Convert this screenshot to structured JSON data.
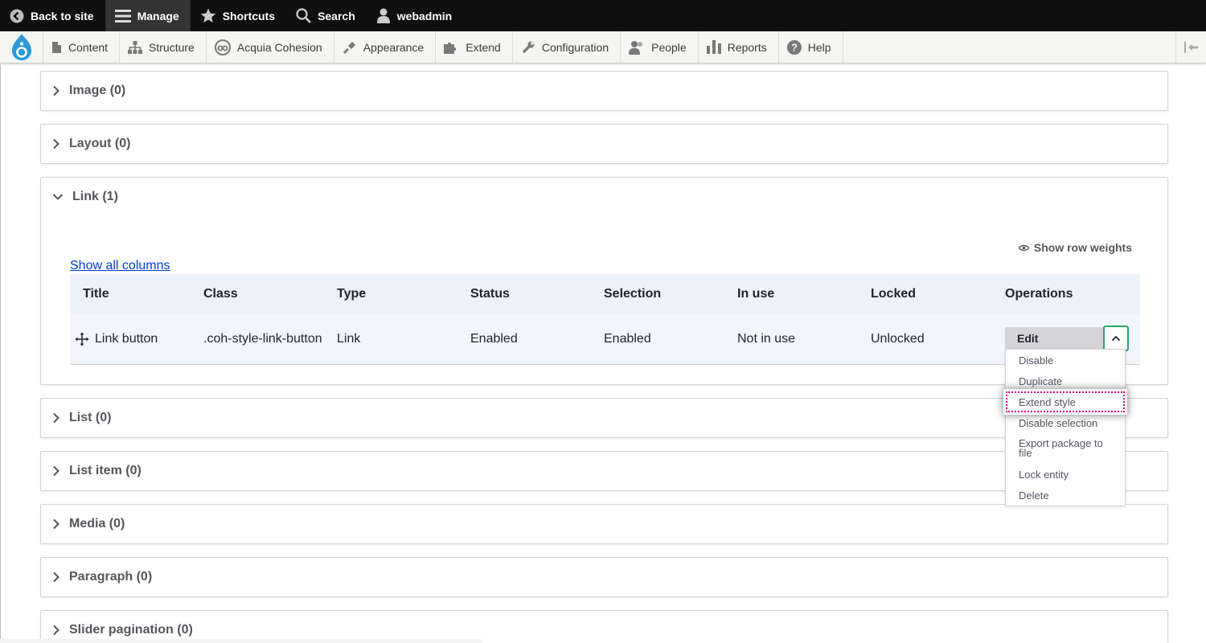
{
  "toolbar": {
    "back_label": "Back to site",
    "manage_label": "Manage",
    "shortcuts_label": "Shortcuts",
    "search_label": "Search",
    "user_label": "webadmin"
  },
  "tray": {
    "items": [
      {
        "label": "Content",
        "icon": "file-icon"
      },
      {
        "label": "Structure",
        "icon": "sitemap-icon"
      },
      {
        "label": "Acquia Cohesion",
        "icon": "cohesion-icon"
      },
      {
        "label": "Appearance",
        "icon": "paintbrush-icon"
      },
      {
        "label": "Extend",
        "icon": "puzzle-icon"
      },
      {
        "label": "Configuration",
        "icon": "wrench-icon"
      },
      {
        "label": "People",
        "icon": "people-icon"
      },
      {
        "label": "Reports",
        "icon": "bar-chart-icon"
      },
      {
        "label": "Help",
        "icon": "help-icon"
      }
    ]
  },
  "sections": {
    "image": "Image (0)",
    "layout": "Layout (0)",
    "link": "Link (1)",
    "list": "List (0)",
    "list_item": "List item (0)",
    "media": "Media (0)",
    "paragraph": "Paragraph (0)",
    "slider_pagination": "Slider pagination (0)"
  },
  "link_section": {
    "show_row_weights": "Show row weights",
    "show_all_columns": "Show all columns",
    "headers": {
      "title": "Title",
      "class": "Class",
      "type": "Type",
      "status": "Status",
      "selection": "Selection",
      "in_use": "In use",
      "locked": "Locked",
      "operations": "Operations"
    },
    "row": {
      "title": "Link button",
      "class": ".coh-style-link-button",
      "type": "Link",
      "status": "Enabled",
      "selection": "Enabled",
      "in_use": "Not in use",
      "locked": "Unlocked"
    }
  },
  "operations": {
    "edit_label": "Edit",
    "menu": {
      "disable": "Disable",
      "duplicate": "Duplicate",
      "extend_style": "Extend style",
      "disable_selection": "Disable selection",
      "export_package": "Export package to file",
      "lock_entity": "Lock entity",
      "delete": "Delete"
    }
  },
  "colors": {
    "toolbar_bg": "#0f0f0f",
    "link": "#003ecc",
    "focus_ring": "#26a769",
    "focus_outline": "#e4007c"
  }
}
